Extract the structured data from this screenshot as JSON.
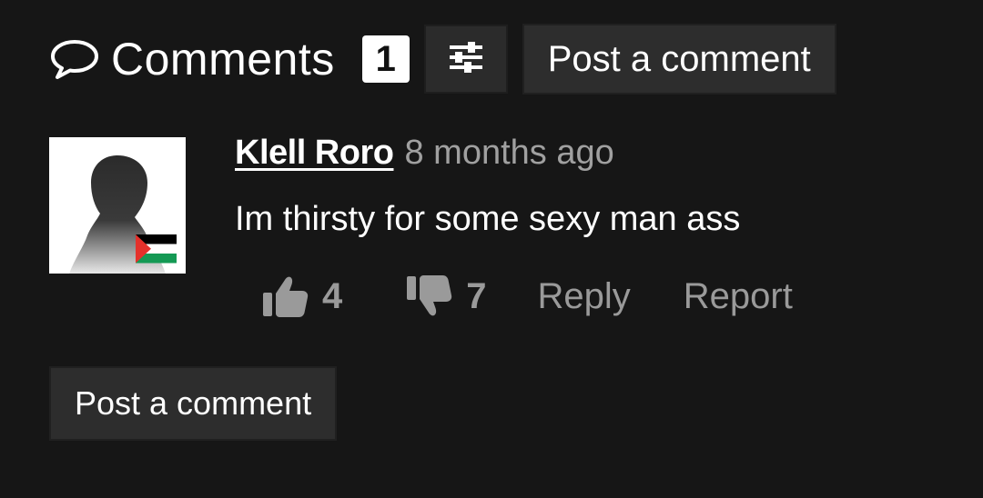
{
  "header": {
    "icon": "speech-bubble-icon",
    "title": "Comments",
    "count": "1",
    "sort_icon": "sliders-icon",
    "post_label": "Post a comment"
  },
  "comments": [
    {
      "avatar": "silhouette-avatar",
      "flag": "palestine-flag-icon",
      "flag_colors": [
        "#000000",
        "#ffffff",
        "#149954",
        "#e4312b"
      ],
      "username": "Klell Roro",
      "time": "8 months ago",
      "text": "Im thirsty for some sexy man ass",
      "likes": "4",
      "dislikes": "7",
      "reply_label": "Reply",
      "report_label": "Report"
    }
  ],
  "footer": {
    "post_label": "Post a comment"
  },
  "colors": {
    "background": "#161616",
    "button": "#2d2d2d",
    "muted_text": "#9a9a9a"
  }
}
